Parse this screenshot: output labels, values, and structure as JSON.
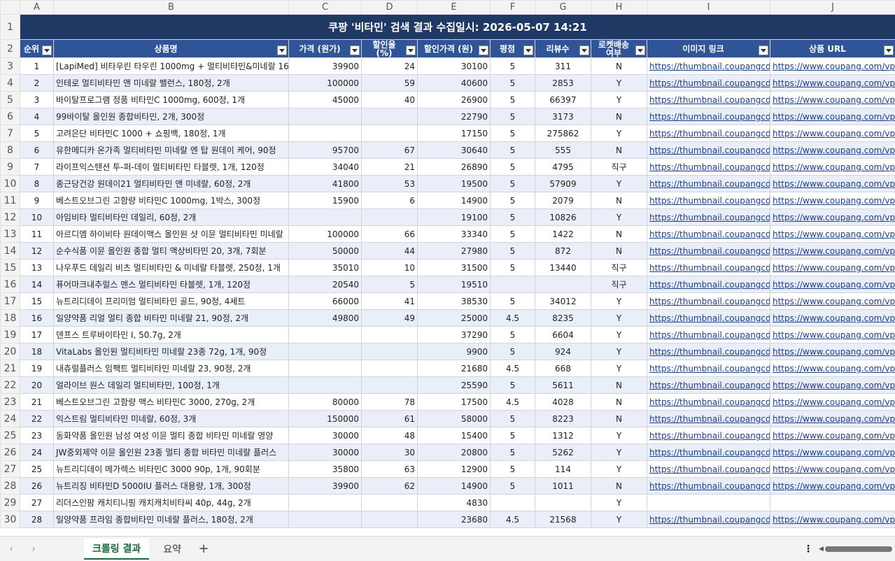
{
  "columns": [
    "",
    "A",
    "B",
    "C",
    "D",
    "E",
    "F",
    "G",
    "H",
    "I",
    "J"
  ],
  "title": "쿠팡 '비타민' 검색 결과        수집일시: 2026-05-07 14:21",
  "headers": [
    "순위",
    "상품명",
    "가격 (원가)",
    "할인율 (%)",
    "할인가격 (원)",
    "평점",
    "리뷰수",
    "로켓배송 여부",
    "이미지 링크",
    "상품 URL"
  ],
  "rows": [
    {
      "n": "3",
      "rank": "1",
      "name": "[LapiMed] 비타우린 타우린 1000mg + 멀티비타민&미네랄 16",
      "price": "39900",
      "disc": "24",
      "dprice": "30100",
      "rating": "5",
      "reviews": "311",
      "rocket": "N",
      "img": "https://thumbnail.coupangcdn.com",
      "url": "https://www.coupang.com/vp/products"
    },
    {
      "n": "4",
      "rank": "2",
      "name": "인테로 멀티비타민 앤 미네랄 밸런스, 180정, 2개",
      "price": "100000",
      "disc": "59",
      "dprice": "40600",
      "rating": "5",
      "reviews": "2853",
      "rocket": "Y",
      "img": "https://thumbnail.coupangcdn.com",
      "url": "https://www.coupang.com/vp/products"
    },
    {
      "n": "5",
      "rank": "3",
      "name": "바이탈프로그램 정품 비타민C 1000mg, 600정, 1개",
      "price": "45000",
      "disc": "40",
      "dprice": "26900",
      "rating": "5",
      "reviews": "66397",
      "rocket": "Y",
      "img": "https://thumbnail.coupangcdn.com",
      "url": "https://www.coupang.com/vp/products"
    },
    {
      "n": "6",
      "rank": "4",
      "name": "99바이탈 올인원 종합비타민, 2개, 300정",
      "price": "",
      "disc": "",
      "dprice": "22790",
      "rating": "5",
      "reviews": "3173",
      "rocket": "N",
      "img": "https://thumbnail.coupangcdn.com",
      "url": "https://www.coupang.com/vp/products"
    },
    {
      "n": "7",
      "rank": "5",
      "name": "고려은단 비타민C 1000 + 쇼핑백, 180정, 1개",
      "price": "",
      "disc": "",
      "dprice": "17150",
      "rating": "5",
      "reviews": "275862",
      "rocket": "Y",
      "img": "https://thumbnail.coupangcdn.com",
      "url": "https://www.coupang.com/vp/products"
    },
    {
      "n": "8",
      "rank": "6",
      "name": "유한메디카 온가족 멀티비타민 미네랄 엔 탑 원데이 케어, 90정",
      "price": "95700",
      "disc": "67",
      "dprice": "30640",
      "rating": "5",
      "reviews": "555",
      "rocket": "N",
      "img": "https://thumbnail.coupangcdn.com",
      "url": "https://www.coupang.com/vp/products"
    },
    {
      "n": "9",
      "rank": "7",
      "name": "라이프익스텐션 투-퍼-데이 멀티비타민 타블렛, 1개, 120정",
      "price": "34040",
      "disc": "21",
      "dprice": "26890",
      "rating": "5",
      "reviews": "4795",
      "rocket": "직구",
      "img": "https://thumbnail.coupangcdn.com",
      "url": "https://www.coupang.com/vp/products"
    },
    {
      "n": "10",
      "rank": "8",
      "name": "종근당건강 원데이21 멀티비타민 앤 미네랄, 60정, 2개",
      "price": "41800",
      "disc": "53",
      "dprice": "19500",
      "rating": "5",
      "reviews": "57909",
      "rocket": "Y",
      "img": "https://thumbnail.coupangcdn.com",
      "url": "https://www.coupang.com/vp/products"
    },
    {
      "n": "11",
      "rank": "9",
      "name": "베스트오브그린 고함량 비타민C 1000mg, 1박스, 300정",
      "price": "15900",
      "disc": "6",
      "dprice": "14900",
      "rating": "5",
      "reviews": "2079",
      "rocket": "N",
      "img": "https://thumbnail.coupangcdn.com",
      "url": "https://www.coupang.com/vp/products"
    },
    {
      "n": "12",
      "rank": "10",
      "name": "아임비타 멀티비타민 데일리, 60정, 2개",
      "price": "",
      "disc": "",
      "dprice": "19100",
      "rating": "5",
      "reviews": "10826",
      "rocket": "Y",
      "img": "https://thumbnail.coupangcdn.com",
      "url": "https://www.coupang.com/vp/products"
    },
    {
      "n": "13",
      "rank": "11",
      "name": "아르디엠 하이비타 원데이맥스 올인원 샷 이뮨 멀티비타민 미네랄",
      "price": "100000",
      "disc": "66",
      "dprice": "33340",
      "rating": "5",
      "reviews": "1422",
      "rocket": "N",
      "img": "https://thumbnail.coupangcdn.com",
      "url": "https://www.coupang.com/vp/products"
    },
    {
      "n": "14",
      "rank": "12",
      "name": "순수식품 이뮨 올인원 종합 멀티 액상비타민 20, 3개, 7회분",
      "price": "50000",
      "disc": "44",
      "dprice": "27980",
      "rating": "5",
      "reviews": "872",
      "rocket": "N",
      "img": "https://thumbnail.coupangcdn.com",
      "url": "https://www.coupang.com/vp/products"
    },
    {
      "n": "15",
      "rank": "13",
      "name": "나우푸드 데일리 비츠 멀티비타민 & 미네랄 타블렛, 250정, 1개",
      "price": "35010",
      "disc": "10",
      "dprice": "31500",
      "rating": "5",
      "reviews": "13440",
      "rocket": "직구",
      "img": "https://thumbnail.coupangcdn.com",
      "url": "https://www.coupang.com/vp/products"
    },
    {
      "n": "16",
      "rank": "14",
      "name": "퓨어마크내추럴스 멘스 멀티비타민 타블렛, 1개, 120정",
      "price": "20540",
      "disc": "5",
      "dprice": "19510",
      "rating": "",
      "reviews": "",
      "rocket": "직구",
      "img": "https://thumbnail.coupangcdn.com",
      "url": "https://www.coupang.com/vp/products"
    },
    {
      "n": "17",
      "rank": "15",
      "name": "뉴트리디데이 프리미엄 멀티비타민 골드, 90정, 4세트",
      "price": "66000",
      "disc": "41",
      "dprice": "38530",
      "rating": "5",
      "reviews": "34012",
      "rocket": "Y",
      "img": "https://thumbnail.coupangcdn.com",
      "url": "https://www.coupang.com/vp/products"
    },
    {
      "n": "18",
      "rank": "16",
      "name": "일양약품 리얼 멀티 종합 비타민 미네랄 21, 90정, 2개",
      "price": "49800",
      "disc": "49",
      "dprice": "25000",
      "rating": "4.5",
      "reviews": "8235",
      "rocket": "Y",
      "img": "https://thumbnail.coupangcdn.com",
      "url": "https://www.coupang.com/vp/products"
    },
    {
      "n": "19",
      "rank": "17",
      "name": "덴프스 트루바이타민 I, 50.7g, 2개",
      "price": "",
      "disc": "",
      "dprice": "37290",
      "rating": "5",
      "reviews": "6604",
      "rocket": "Y",
      "img": "https://thumbnail.coupangcdn.com",
      "url": "https://www.coupang.com/vp/products"
    },
    {
      "n": "20",
      "rank": "18",
      "name": "VitaLabs 올인원 멀티비타민 미네랄 23종 72g, 1개, 90정",
      "price": "",
      "disc": "",
      "dprice": "9900",
      "rating": "5",
      "reviews": "924",
      "rocket": "Y",
      "img": "https://thumbnail.coupangcdn.com",
      "url": "https://www.coupang.com/vp/products"
    },
    {
      "n": "21",
      "rank": "19",
      "name": "내츄럴플러스 임팩트 멀티비타민 미네랄 23, 90정, 2개",
      "price": "",
      "disc": "",
      "dprice": "21680",
      "rating": "4.5",
      "reviews": "668",
      "rocket": "Y",
      "img": "https://thumbnail.coupangcdn.com",
      "url": "https://www.coupang.com/vp/products"
    },
    {
      "n": "22",
      "rank": "20",
      "name": "얼라이브 원스 데일리 멀티비타민, 100정, 1개",
      "price": "",
      "disc": "",
      "dprice": "25590",
      "rating": "5",
      "reviews": "5611",
      "rocket": "N",
      "img": "https://thumbnail.coupangcdn.com",
      "url": "https://www.coupang.com/vp/products"
    },
    {
      "n": "23",
      "rank": "21",
      "name": "베스트오브그린 고함량 맥스 비타민C 3000, 270g, 2개",
      "price": "80000",
      "disc": "78",
      "dprice": "17500",
      "rating": "4.5",
      "reviews": "4028",
      "rocket": "N",
      "img": "https://thumbnail.coupangcdn.com",
      "url": "https://www.coupang.com/vp/products"
    },
    {
      "n": "24",
      "rank": "22",
      "name": "익스트림 멀티비타민 미네랄, 60정, 3개",
      "price": "150000",
      "disc": "61",
      "dprice": "58000",
      "rating": "5",
      "reviews": "8223",
      "rocket": "N",
      "img": "https://thumbnail.coupangcdn.com",
      "url": "https://www.coupang.com/vp/products"
    },
    {
      "n": "25",
      "rank": "23",
      "name": "동화약품 올인원 남성 여성 이뮨 멀티 종합 비타민 미네랄 영양",
      "price": "30000",
      "disc": "48",
      "dprice": "15400",
      "rating": "5",
      "reviews": "1312",
      "rocket": "Y",
      "img": "https://thumbnail.coupangcdn.com",
      "url": "https://www.coupang.com/vp/products"
    },
    {
      "n": "26",
      "rank": "24",
      "name": "JW중외제약 이뮨 올인원 23종 멀티 종합 비타민 미네랄 플러스",
      "price": "30000",
      "disc": "30",
      "dprice": "20800",
      "rating": "5",
      "reviews": "5262",
      "rocket": "Y",
      "img": "https://thumbnail.coupangcdn.com",
      "url": "https://www.coupang.com/vp/products"
    },
    {
      "n": "27",
      "rank": "25",
      "name": "뉴트리디데이 메가렉스 비타민C 3000 90p, 1개, 90회분",
      "price": "35800",
      "disc": "63",
      "dprice": "12900",
      "rating": "5",
      "reviews": "114",
      "rocket": "Y",
      "img": "https://thumbnail.coupangcdn.com",
      "url": "https://www.coupang.com/vp/products"
    },
    {
      "n": "28",
      "rank": "26",
      "name": "뉴트리징 비타민D 5000IU 플러스 대용량, 1개, 300정",
      "price": "39900",
      "disc": "62",
      "dprice": "14900",
      "rating": "5",
      "reviews": "1011",
      "rocket": "N",
      "img": "https://thumbnail.coupangcdn.com",
      "url": "https://www.coupang.com/vp/products"
    },
    {
      "n": "29",
      "rank": "27",
      "name": "리더스인팜 캐치티니핑 캐치캐치비타씨 40p, 44g, 2개",
      "price": "",
      "disc": "",
      "dprice": "4830",
      "rating": "",
      "reviews": "",
      "rocket": "Y",
      "img": "",
      "url": ""
    },
    {
      "n": "30",
      "rank": "28",
      "name": "일양약품 프라임 종합비타민 미네랄 플러스, 180정, 2개",
      "price": "",
      "disc": "",
      "dprice": "23680",
      "rating": "4.5",
      "reviews": "21568",
      "rocket": "Y",
      "img": "https://thumbnail.coupangcdn.com",
      "url": "https://www.coupang.com/vp/products"
    }
  ],
  "tabs": {
    "nav_prev": "‹",
    "nav_next": "›",
    "sheet1": "크롤링 결과",
    "sheet2": "요약",
    "add": "+",
    "more": "⋮"
  }
}
